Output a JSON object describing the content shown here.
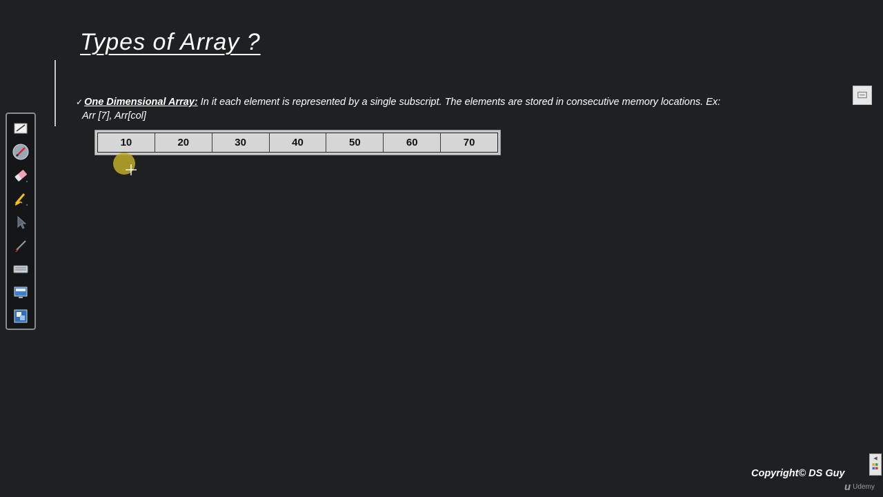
{
  "slide": {
    "title": "Types of Array ?"
  },
  "toolbar": {
    "tools": [
      {
        "name": "notepad-icon"
      },
      {
        "name": "pen-icon"
      },
      {
        "name": "eraser-icon"
      },
      {
        "name": "highlighter-icon"
      },
      {
        "name": "pointer-icon"
      },
      {
        "name": "brush-icon"
      },
      {
        "name": "keyboard-icon"
      },
      {
        "name": "screen-capture-icon"
      },
      {
        "name": "window-switch-icon"
      }
    ]
  },
  "content": {
    "check_mark": "✓",
    "term": "One Dimensional Array:",
    "description": " In it each element is represented by a single subscript. The elements are stored in consecutive memory locations. Ex:",
    "example": "Arr [7], Arr[col]"
  },
  "array": {
    "values": [
      "10",
      "20",
      "30",
      "40",
      "50",
      "60",
      "70"
    ]
  },
  "footer": {
    "copyright": "Copyright© DS Guy",
    "udemy_label": "Udemy"
  },
  "colors": {
    "background": "#1e2021",
    "cursor_highlight": "#beaa28"
  }
}
